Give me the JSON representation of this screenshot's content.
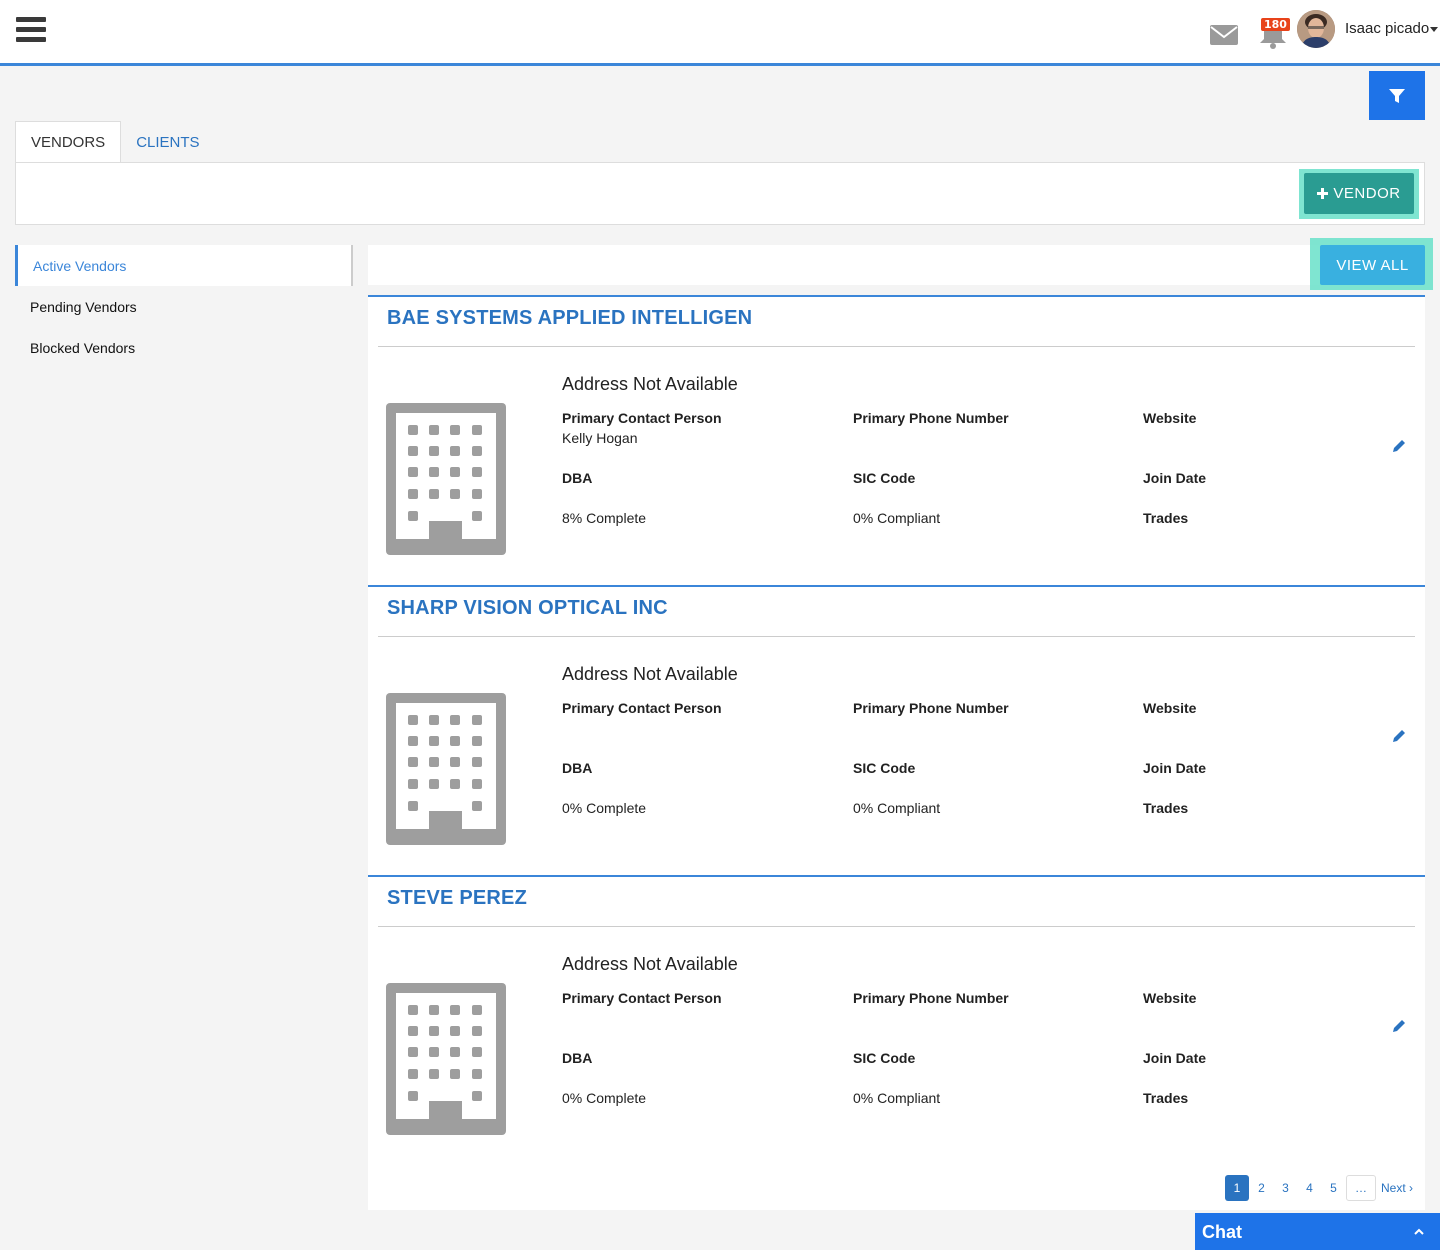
{
  "topbar": {
    "menu_icon": "hamburger-icon",
    "mail_icon": "envelope-icon",
    "notifications_icon": "bell-icon",
    "notification_count": "180",
    "user_name": "Isaac picado",
    "accent_color": "#3b86d9"
  },
  "filter_icon": "filter-icon",
  "tabs": [
    {
      "label": "VENDORS",
      "active": true
    },
    {
      "label": "CLIENTS",
      "active": false
    }
  ],
  "add_vendor_label": "VENDOR",
  "add_vendor_icon": "plus-icon",
  "sidebar": {
    "items": [
      {
        "label": "Active Vendors",
        "active": true
      },
      {
        "label": "Pending Vendors",
        "active": false
      },
      {
        "label": "Blocked Vendors",
        "active": false
      }
    ]
  },
  "view_all_label": "VIEW ALL",
  "vendors": [
    {
      "name": "BAE SYSTEMS APPLIED INTELLIGEN",
      "address": "Address Not Available",
      "contact_label": "Primary Contact Person",
      "contact_value": "Kelly Hogan",
      "phone_label": "Primary Phone Number",
      "website_label": "Website",
      "dba_label": "DBA",
      "sic_label": "SIC Code",
      "join_label": "Join Date",
      "complete": "8% Complete",
      "compliant": "0% Compliant",
      "trades_label": "Trades"
    },
    {
      "name": "SHARP VISION OPTICAL INC",
      "address": "Address Not Available",
      "contact_label": "Primary Contact Person",
      "contact_value": "",
      "phone_label": "Primary Phone Number",
      "website_label": "Website",
      "dba_label": "DBA",
      "sic_label": "SIC Code",
      "join_label": "Join Date",
      "complete": "0% Complete",
      "compliant": "0% Compliant",
      "trades_label": "Trades"
    },
    {
      "name": "STEVE PEREZ",
      "address": "Address Not Available",
      "contact_label": "Primary Contact Person",
      "contact_value": "",
      "phone_label": "Primary Phone Number",
      "website_label": "Website",
      "dba_label": "DBA",
      "sic_label": "SIC Code",
      "join_label": "Join Date",
      "complete": "0% Complete",
      "compliant": "0% Compliant",
      "trades_label": "Trades"
    }
  ],
  "pagination": {
    "pages": [
      "1",
      "2",
      "3",
      "4",
      "5"
    ],
    "current": "1",
    "ellipsis": "…",
    "next": "Next ›"
  },
  "chat": {
    "label": "Chat",
    "icon": "chevron-up-icon"
  }
}
